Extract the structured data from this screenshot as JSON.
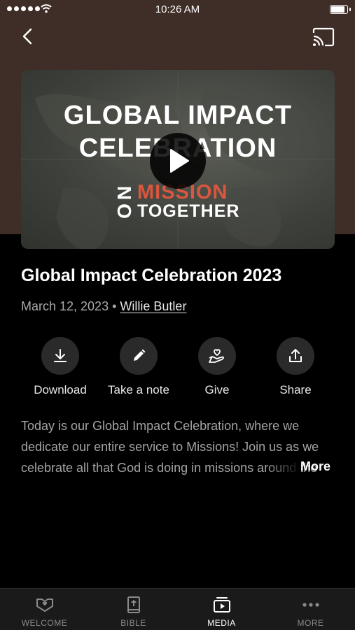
{
  "status_bar": {
    "time": "10:26 AM"
  },
  "video": {
    "thumb_title_line1": "GLOBAL IMPACT",
    "thumb_title_line2": "CELEBRATION",
    "logo_on": "ON",
    "logo_mission": "MISSION",
    "logo_together": "TOGETHER"
  },
  "sermon": {
    "title": "Global Impact Celebration 2023",
    "date": "March 12, 2023",
    "separator": "•",
    "speaker": "Willie Butler",
    "description": "Today is our Global Impact Celebration, where we dedicate our entire service to Missions! Join us as we celebrate all that God is doing in missions around the world.",
    "more_label": "More"
  },
  "actions": [
    {
      "label": "Download",
      "icon": "download-icon"
    },
    {
      "label": "Take a note",
      "icon": "pencil-icon"
    },
    {
      "label": "Give",
      "icon": "give-heart-hand-icon"
    },
    {
      "label": "Share",
      "icon": "share-icon"
    }
  ],
  "tabs": [
    {
      "label": "WELCOME",
      "icon": "handshake-heart-icon",
      "active": false
    },
    {
      "label": "BIBLE",
      "icon": "bible-icon",
      "active": false
    },
    {
      "label": "MEDIA",
      "icon": "media-play-icon",
      "active": true
    },
    {
      "label": "MORE",
      "icon": "more-dots-icon",
      "active": false
    }
  ],
  "colors": {
    "hero_bg": "#3f2e27",
    "accent_mission": "#d9573f",
    "background": "#000000",
    "tabbar": "#1a1a1a"
  }
}
